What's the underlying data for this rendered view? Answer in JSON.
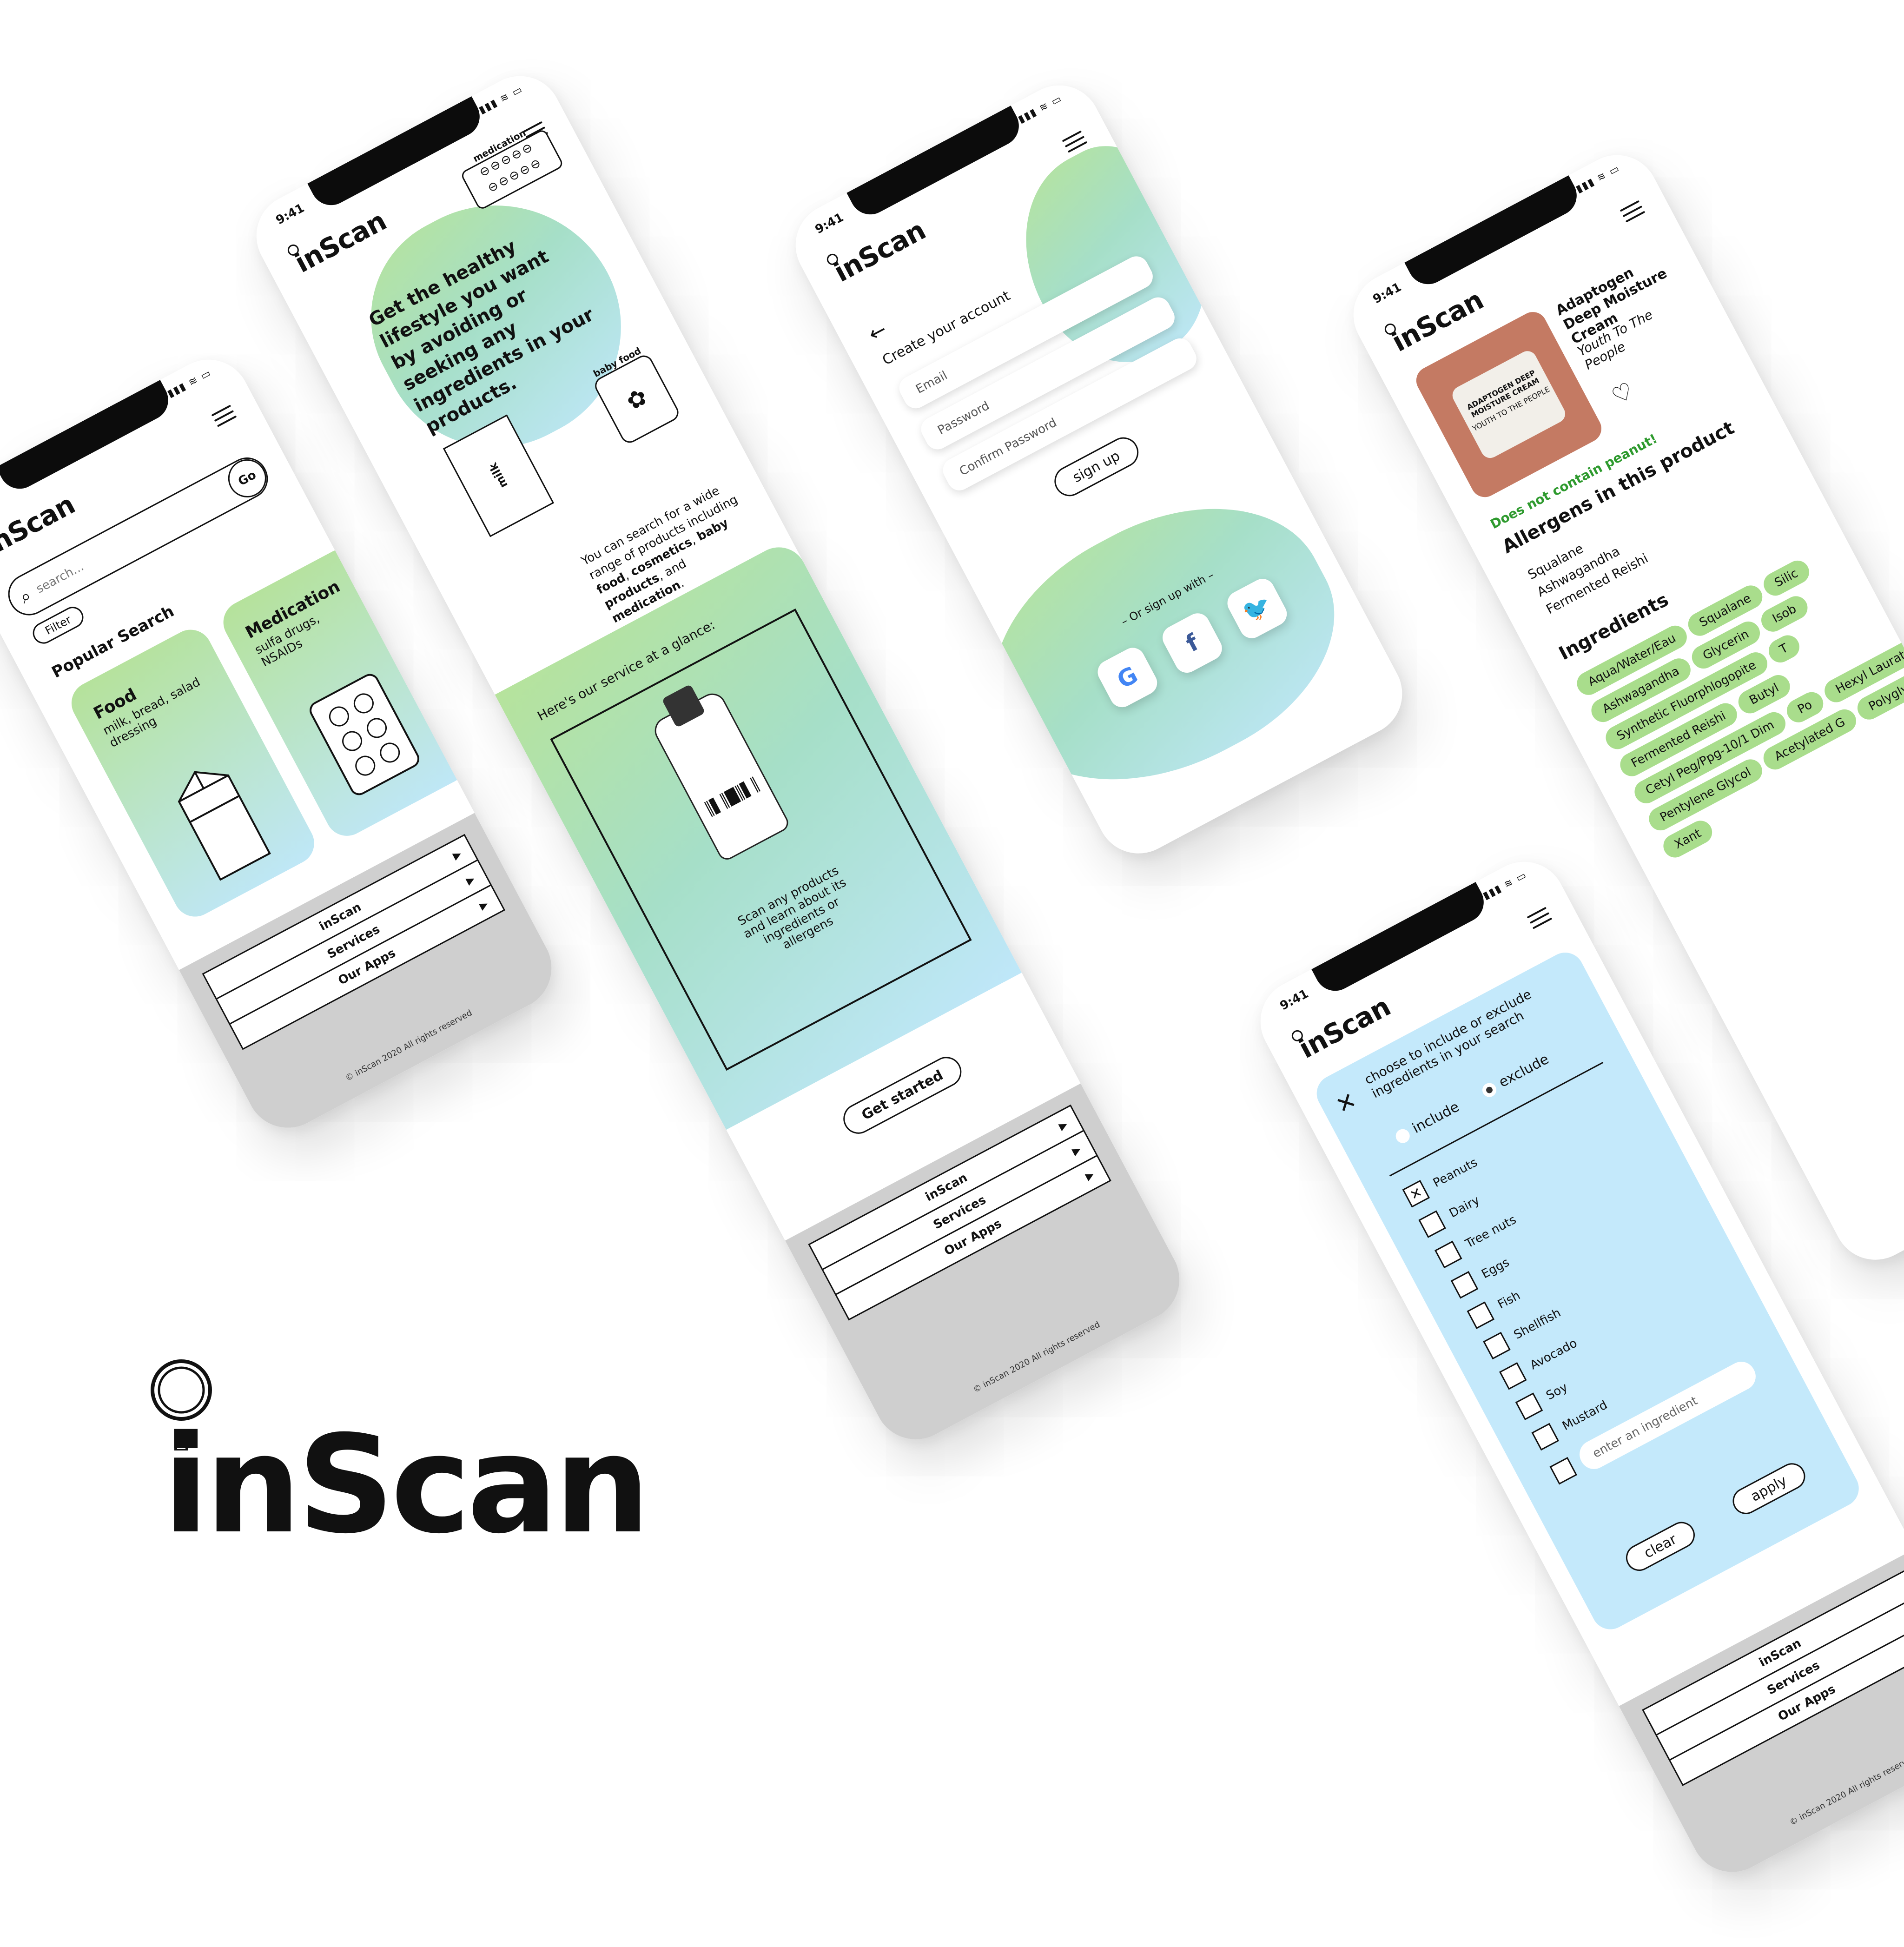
{
  "status": {
    "time": "9:41",
    "signal": "▮▮▮ ≋ ▭"
  },
  "brand": {
    "name": "inScan"
  },
  "footer": {
    "links": [
      "inScan",
      "Services",
      "Our Apps"
    ],
    "copyright": "© inScan 2020 All rights reserved"
  },
  "search_screen": {
    "placeholder": "search...",
    "go_label": "Go",
    "filter_label": "Filter",
    "popular_title": "Popular Search",
    "cards": [
      {
        "title": "Food",
        "subtitle": "milk, bread, salad dressing"
      },
      {
        "title": "Medication",
        "subtitle": "sulfa drugs, NSAIDs"
      }
    ]
  },
  "landing_screen": {
    "medication_label": "medication",
    "baby_food_label": "baby food",
    "milk_label": "milk",
    "hero_text": "Get the healthy lifestyle you want by avoiding or seeking any ingredients in your products.",
    "desc_plain_1": "You can search for a wide range of products including ",
    "desc_bold_1": "food",
    "desc_plain_2": ", ",
    "desc_bold_2": "cosmetics",
    "desc_plain_3": ", ",
    "desc_bold_3": "baby products",
    "desc_plain_4": ", and ",
    "desc_bold_4": "medication",
    "desc_plain_5": ".",
    "glance_title": "Here's our service at a glance:",
    "scan_text": "Scan any products and learn about its ingredients or allergens",
    "cta_label": "Get started"
  },
  "signup_screen": {
    "title": "Create your account",
    "email_placeholder": "Email",
    "password_placeholder": "Password",
    "confirm_placeholder": "Confirm Password",
    "signup_label": "sign up",
    "or_label": "– Or sign up with –",
    "social": [
      "G",
      "f",
      "🐦"
    ]
  },
  "product_screen": {
    "product_name": "Adaptogen Deep Moisture Cream",
    "brand": "Youth To The People",
    "jar_text": "ADAPTOGEN DEEP MOISTURE CREAM",
    "jar_brand": "YOUTH TO THE PEOPLE",
    "peanut_note": "Does not contain peanut!",
    "allergens_title": "Allergens in this product",
    "allergens": [
      "Squalane",
      "Ashwagandha",
      "Fermented Reishi"
    ],
    "ingredients_title": "Ingredients",
    "ingredients": [
      "Aqua/Water/Eau",
      "Squalane",
      "Silic",
      "Ashwagandha",
      "Glycerin",
      "Isob",
      "Synthetic Fluorphlogopite",
      "T",
      "Fermented Reishi",
      "Butyl",
      "Cetyl Peg/Ppg-10/1 Dim",
      "Po",
      "Hexyl Laurate",
      "Pentylene Glycol",
      "Acetylated G",
      "Polyglyc",
      "Xant"
    ],
    "colors": {
      "accent": "#a9dd8c",
      "note": "#2e9a2e"
    }
  },
  "filter_screen": {
    "heading": "choose to include or exclude ingredients in your search",
    "include_label": "include",
    "exclude_label": "exclude",
    "items": [
      {
        "label": "Peanuts",
        "checked": true
      },
      {
        "label": "Dairy",
        "checked": false
      },
      {
        "label": "Tree nuts",
        "checked": false
      },
      {
        "label": "Eggs",
        "checked": false
      },
      {
        "label": "Fish",
        "checked": false
      },
      {
        "label": "Shellfish",
        "checked": false
      },
      {
        "label": "Avocado",
        "checked": false
      },
      {
        "label": "Soy",
        "checked": false
      },
      {
        "label": "Mustard",
        "checked": false
      }
    ],
    "ingredient_placeholder": "enter an ingredient",
    "clear_label": "clear",
    "apply_label": "apply"
  },
  "big_logo": {
    "text": "inScan"
  }
}
